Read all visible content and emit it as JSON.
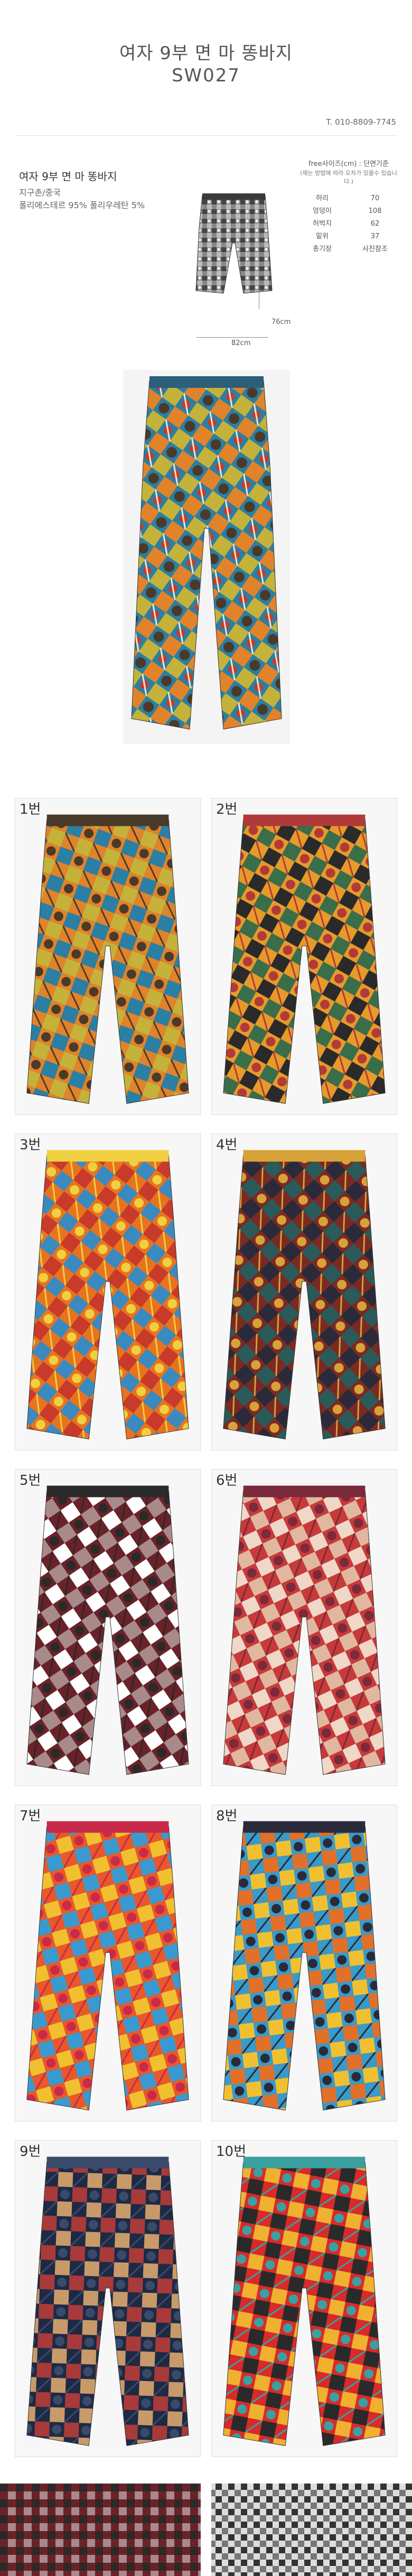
{
  "header": {
    "title": "여자 9부 면 마 똥바지",
    "code": "SW027",
    "phone": "T. 010-8809-7745"
  },
  "product": {
    "name": "여자 9부 면 마 똥바지",
    "origin": "지구촌/중국",
    "material": "폴리에스테르 95% 폴리우레탄 5%"
  },
  "size_chart": {
    "heading": "free사이즈(cm) : 단면기준",
    "note": "(재는 방법에 따라 오차가 있을수 있습니다.)",
    "rows": [
      {
        "label": "허리",
        "value": "70"
      },
      {
        "label": "엉덩이",
        "value": "108"
      },
      {
        "label": "허벅지",
        "value": "62"
      },
      {
        "label": "밑위",
        "value": "37"
      },
      {
        "label": "총기장",
        "value": "사진참조"
      }
    ],
    "dim_height": "76cm",
    "dim_width": "82cm"
  },
  "variants": [
    {
      "label": "1번",
      "c1": "#e0832a",
      "c2": "#2b7fa3",
      "c3": "#4a3a2a",
      "c4": "#c4b23a"
    },
    {
      "label": "2번",
      "c1": "#e79a2a",
      "c2": "#3a6e4a",
      "c3": "#b03a3a",
      "c4": "#2a2a2a"
    },
    {
      "label": "3번",
      "c1": "#e8731f",
      "c2": "#3a8ac0",
      "c3": "#f0d040",
      "c4": "#c83a2a"
    },
    {
      "label": "4번",
      "c1": "#7a2a22",
      "c2": "#2a5a5a",
      "c3": "#d8a23a",
      "c4": "#2a2a3a"
    },
    {
      "label": "5번",
      "c1": "#6a2228",
      "c2": "#ffffff",
      "c3": "#2a2a2a",
      "c4": "#a88a8a"
    },
    {
      "label": "6번",
      "c1": "#c83a3a",
      "c2": "#e0b8a0",
      "c3": "#7a2a3a",
      "c4": "#f0d8c8"
    },
    {
      "label": "7번",
      "c1": "#e8582a",
      "c2": "#3a9ad0",
      "c3": "#c82a4a",
      "c4": "#f0c030"
    },
    {
      "label": "8번",
      "c1": "#3a9ac8",
      "c2": "#e0702a",
      "c3": "#2a2a3a",
      "c4": "#f0c030"
    },
    {
      "label": "9번",
      "c1": "#1e2a44",
      "c2": "#c89a6a",
      "c3": "#3a4a6a",
      "c4": "#a83a3a"
    },
    {
      "label": "10번",
      "c1": "#d82a2a",
      "c2": "#2a2a2a",
      "c3": "#3aa0a0",
      "c4": "#f0b030"
    }
  ]
}
